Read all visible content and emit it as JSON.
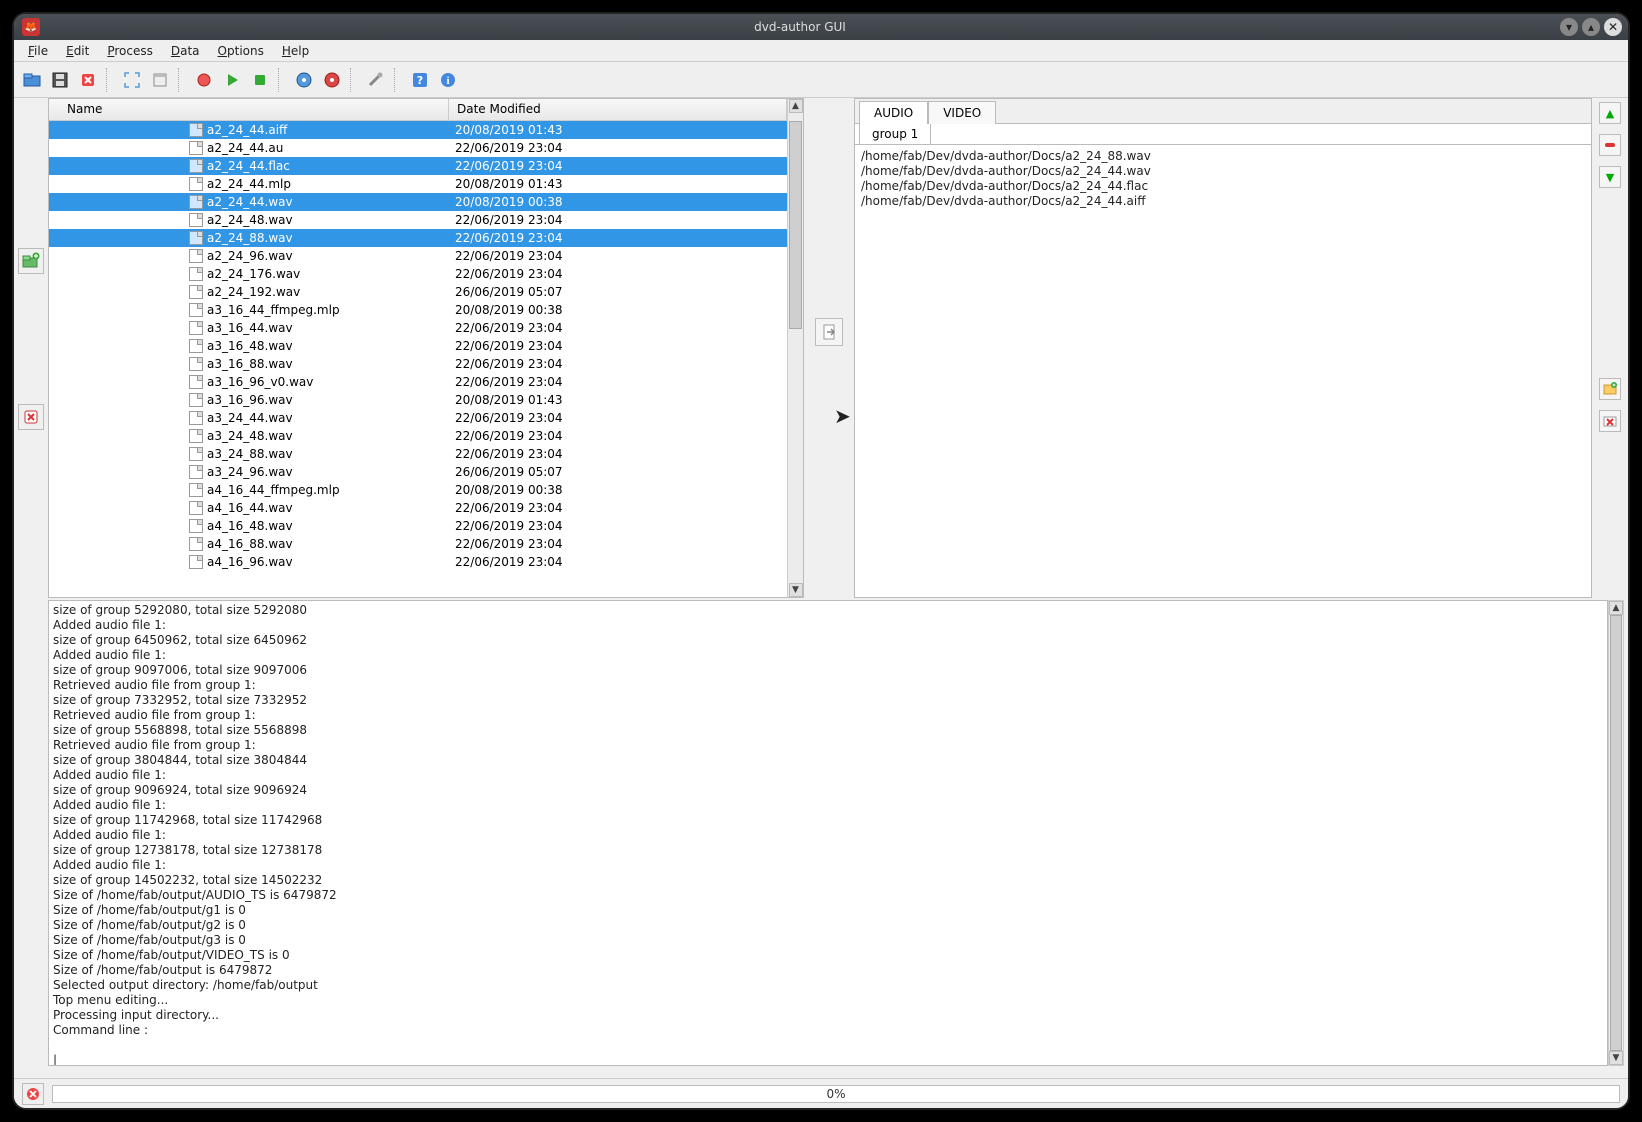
{
  "window": {
    "title": "dvd-author GUI"
  },
  "menu": {
    "file": "File",
    "edit": "Edit",
    "process": "Process",
    "data": "Data",
    "options": "Options",
    "help": "Help"
  },
  "filelist": {
    "headers": {
      "name": "Name",
      "date": "Date Modified"
    },
    "rows": [
      {
        "name": "a2_24_44.aiff",
        "date": "20/08/2019 01:43",
        "sel": true
      },
      {
        "name": "a2_24_44.au",
        "date": "22/06/2019 23:04",
        "sel": false
      },
      {
        "name": "a2_24_44.flac",
        "date": "22/06/2019 23:04",
        "sel": true
      },
      {
        "name": "a2_24_44.mlp",
        "date": "20/08/2019 01:43",
        "sel": false
      },
      {
        "name": "a2_24_44.wav",
        "date": "20/08/2019 00:38",
        "sel": true
      },
      {
        "name": "a2_24_48.wav",
        "date": "22/06/2019 23:04",
        "sel": false
      },
      {
        "name": "a2_24_88.wav",
        "date": "22/06/2019 23:04",
        "sel": true
      },
      {
        "name": "a2_24_96.wav",
        "date": "22/06/2019 23:04",
        "sel": false
      },
      {
        "name": "a2_24_176.wav",
        "date": "22/06/2019 23:04",
        "sel": false
      },
      {
        "name": "a2_24_192.wav",
        "date": "26/06/2019 05:07",
        "sel": false
      },
      {
        "name": "a3_16_44_ffmpeg.mlp",
        "date": "20/08/2019 00:38",
        "sel": false
      },
      {
        "name": "a3_16_44.wav",
        "date": "22/06/2019 23:04",
        "sel": false
      },
      {
        "name": "a3_16_48.wav",
        "date": "22/06/2019 23:04",
        "sel": false
      },
      {
        "name": "a3_16_88.wav",
        "date": "22/06/2019 23:04",
        "sel": false
      },
      {
        "name": "a3_16_96_v0.wav",
        "date": "22/06/2019 23:04",
        "sel": false
      },
      {
        "name": "a3_16_96.wav",
        "date": "20/08/2019 01:43",
        "sel": false
      },
      {
        "name": "a3_24_44.wav",
        "date": "22/06/2019 23:04",
        "sel": false
      },
      {
        "name": "a3_24_48.wav",
        "date": "22/06/2019 23:04",
        "sel": false
      },
      {
        "name": "a3_24_88.wav",
        "date": "22/06/2019 23:04",
        "sel": false
      },
      {
        "name": "a3_24_96.wav",
        "date": "26/06/2019 05:07",
        "sel": false
      },
      {
        "name": "a4_16_44_ffmpeg.mlp",
        "date": "20/08/2019 00:38",
        "sel": false
      },
      {
        "name": "a4_16_44.wav",
        "date": "22/06/2019 23:04",
        "sel": false
      },
      {
        "name": "a4_16_48.wav",
        "date": "22/06/2019 23:04",
        "sel": false
      },
      {
        "name": "a4_16_88.wav",
        "date": "22/06/2019 23:04",
        "sel": false
      },
      {
        "name": "a4_16_96.wav",
        "date": "22/06/2019 23:04",
        "sel": false
      }
    ]
  },
  "tabs": {
    "audio": "AUDIO",
    "video": "VIDEO",
    "group": "group 1"
  },
  "group_files": [
    "/home/fab/Dev/dvda-author/Docs/a2_24_88.wav",
    "/home/fab/Dev/dvda-author/Docs/a2_24_44.wav",
    "/home/fab/Dev/dvda-author/Docs/a2_24_44.flac",
    "/home/fab/Dev/dvda-author/Docs/a2_24_44.aiff"
  ],
  "log_lines": [
    "  size of group 5292080, total size 5292080",
    "Added audio file 1:",
    "  size of group 6450962, total size 6450962",
    "Added audio file 1:",
    "  size of group 9097006, total size 9097006",
    "Retrieved audio file from group 1:",
    "  size of group 7332952, total size 7332952",
    "Retrieved audio file from group 1:",
    "  size of group 5568898, total size 5568898",
    "Retrieved audio file from group 1:",
    "  size of group 3804844, total size 3804844",
    "Added audio file 1:",
    "  size of group 9096924, total size 9096924",
    "Added audio file 1:",
    "  size of group 11742968, total size 11742968",
    "Added audio file 1:",
    "  size of group 12738178, total size 12738178",
    "Added audio file 1:",
    "  size of group 14502232, total size 14502232",
    "Size of /home/fab/output/AUDIO_TS is 6479872",
    "Size of /home/fab/output/g1 is 0",
    "Size of /home/fab/output/g2 is 0",
    "Size of /home/fab/output/g3 is 0",
    "Size of /home/fab/output/VIDEO_TS is 0",
    "Size of /home/fab/output is 6479872",
    "Selected output directory: /home/fab/output",
    "Top menu editing...",
    "Processing input directory...",
    "Command line :",
    "",
    "|"
  ],
  "status": {
    "progress_text": "0%"
  }
}
